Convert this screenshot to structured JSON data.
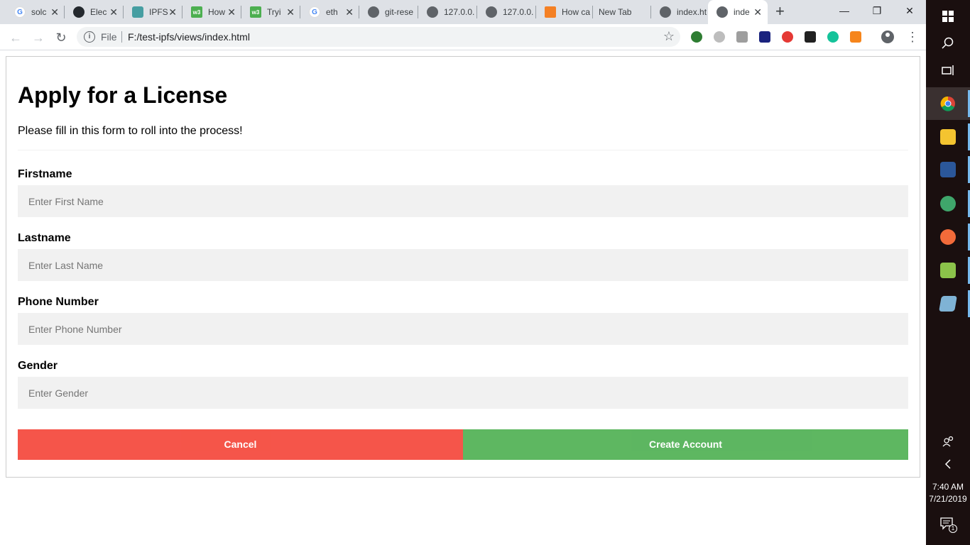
{
  "browser": {
    "tabs": [
      {
        "title": "solc",
        "icon": "google-icon",
        "color": "#4285f4",
        "glyph": "G"
      },
      {
        "title": "Elec",
        "icon": "github-icon",
        "color": "#24292e",
        "glyph": ""
      },
      {
        "title": "IPFS",
        "icon": "ipfs-icon",
        "color": "#469ea2",
        "glyph": ""
      },
      {
        "title": "How",
        "icon": "w3schools-icon",
        "color": "#4caf50",
        "glyph": "w3"
      },
      {
        "title": "Tryi",
        "icon": "w3schools-icon",
        "color": "#4caf50",
        "glyph": "w3"
      },
      {
        "title": "eth",
        "icon": "google-icon",
        "color": "#4285f4",
        "glyph": "G"
      },
      {
        "title": "git-rese",
        "icon": "globe-icon",
        "color": "#5f6368",
        "glyph": ""
      },
      {
        "title": "127.0.0.",
        "icon": "globe-icon",
        "color": "#5f6368",
        "glyph": ""
      },
      {
        "title": "127.0.0.",
        "icon": "globe-icon",
        "color": "#5f6368",
        "glyph": ""
      },
      {
        "title": "How ca",
        "icon": "stackoverflow-icon",
        "color": "#f48024",
        "glyph": ""
      },
      {
        "title": "New Tab",
        "icon": "",
        "color": "",
        "glyph": ""
      },
      {
        "title": "index.ht",
        "icon": "globe-icon",
        "color": "#5f6368",
        "glyph": ""
      },
      {
        "title": "inde",
        "icon": "globe-icon",
        "color": "#5f6368",
        "glyph": "",
        "active": true
      }
    ],
    "new_tab_glyph": "+",
    "minimize_glyph": "—",
    "maximize_glyph": "❐",
    "close_glyph": "✕",
    "back_glyph": "←",
    "forward_glyph": "→",
    "reload_glyph": "↻",
    "omnibox": {
      "info_glyph": "i",
      "scheme": "File",
      "url": "F:/test-ipfs/views/index.html",
      "star_glyph": "☆"
    },
    "menu_glyph": "⋮"
  },
  "page": {
    "title": "Apply for a License",
    "subtitle": "Please fill in this form to roll into the process!",
    "fields": {
      "firstname": {
        "label": "Firstname",
        "placeholder": "Enter First Name",
        "value": ""
      },
      "lastname": {
        "label": "Lastname",
        "placeholder": "Enter Last Name",
        "value": ""
      },
      "phone": {
        "label": "Phone Number",
        "placeholder": "Enter Phone Number",
        "value": ""
      },
      "gender": {
        "label": "Gender",
        "placeholder": "Enter Gender",
        "value": ""
      }
    },
    "buttons": {
      "cancel": "Cancel",
      "create": "Create Account"
    },
    "colors": {
      "cancel": "#f44336",
      "create": "#4caf50"
    }
  },
  "taskbar": {
    "time": "7:40 AM",
    "date": "7/21/2019",
    "notification_count": "1",
    "apps": [
      "windows-start-icon",
      "search-icon",
      "task-view-icon",
      "chrome-icon",
      "file-explorer-icon",
      "word-icon",
      "atom-icon",
      "postman-icon",
      "notepad-plus-icon",
      "app-icon"
    ]
  }
}
